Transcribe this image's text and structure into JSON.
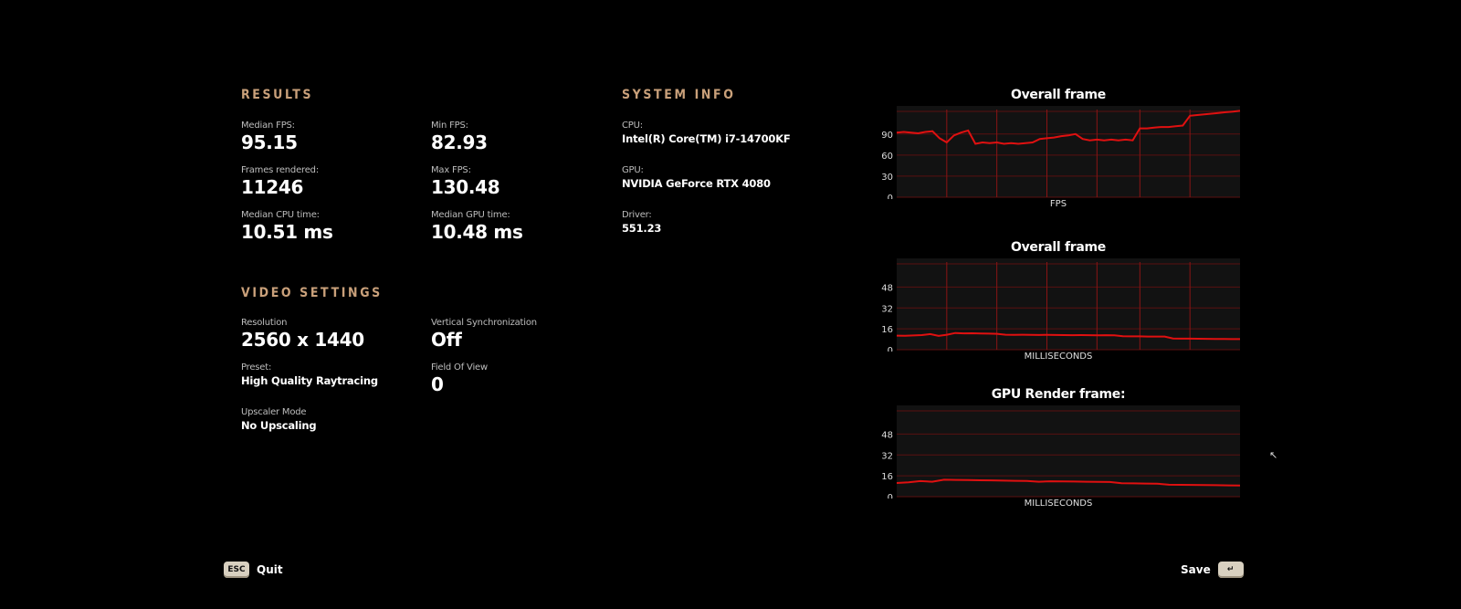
{
  "results": {
    "title": "RESULTS",
    "median_fps": {
      "label": "Median FPS:",
      "value": "95.15"
    },
    "min_fps": {
      "label": "Min FPS:",
      "value": "82.93"
    },
    "frames_rendered": {
      "label": "Frames rendered:",
      "value": "11246"
    },
    "max_fps": {
      "label": "Max FPS:",
      "value": "130.48"
    },
    "median_cpu": {
      "label": "Median CPU time:",
      "value": "10.51 ms"
    },
    "median_gpu": {
      "label": "Median GPU time:",
      "value": "10.48 ms"
    }
  },
  "video_settings": {
    "title": "VIDEO SETTINGS",
    "resolution": {
      "label": "Resolution",
      "value": "2560 x 1440"
    },
    "vsync": {
      "label": "Vertical Synchronization",
      "value": "Off"
    },
    "preset": {
      "label": "Preset:",
      "value": "High Quality Raytracing"
    },
    "fov": {
      "label": "Field Of View",
      "value": "0"
    },
    "upscaler": {
      "label": "Upscaler Mode",
      "value": "No Upscaling"
    }
  },
  "system_info": {
    "title": "SYSTEM INFO",
    "cpu": {
      "label": "CPU:",
      "value": "Intel(R) Core(TM) i7-14700KF"
    },
    "gpu": {
      "label": "GPU:",
      "value": "NVIDIA GeForce RTX 4080"
    },
    "driver": {
      "label": "Driver:",
      "value": "551.23"
    }
  },
  "footer": {
    "quit_key": "ESC",
    "quit_label": "Quit",
    "save_label": "Save",
    "save_key": "↵"
  },
  "colors": {
    "accent": "#c9a07a",
    "line": "#e01010",
    "grid": "#5a1010",
    "panel": "#121212"
  },
  "chart_data": [
    {
      "type": "line",
      "title": "Overall frame",
      "xlabel": "FPS",
      "yticks": [
        0,
        30,
        60,
        90
      ],
      "ylim": [
        0,
        130
      ],
      "series": [
        {
          "values": [
            92,
            93,
            92,
            91,
            93,
            94,
            84,
            78,
            88,
            92,
            95,
            76,
            78,
            77,
            78,
            76,
            77,
            76,
            77,
            78,
            83,
            84,
            85,
            87,
            88,
            90,
            83,
            81,
            82,
            81,
            82,
            81,
            82,
            81,
            98,
            98,
            99,
            100,
            100,
            101,
            102,
            116,
            117,
            118,
            119,
            120,
            121,
            122,
            123
          ]
        }
      ],
      "spikes": [
        7,
        14,
        21,
        28,
        34,
        41
      ]
    },
    {
      "type": "line",
      "title": "Overall frame",
      "xlabel": "MILLISECONDS",
      "yticks": [
        0,
        16,
        32,
        48
      ],
      "ylim": [
        0,
        70
      ],
      "series": [
        {
          "values": [
            10.8,
            10.7,
            10.9,
            11.2,
            12,
            10.6,
            11.5,
            12.8,
            12.5,
            12.6,
            12.4,
            12.3,
            12.2,
            11.5,
            11.4,
            11.5,
            11.4,
            11.3,
            11.4,
            11.3,
            11.2,
            11.1,
            11.2,
            11.1,
            11.0,
            11.1,
            11.0,
            10.3,
            10.2,
            10.2,
            10.1,
            10.1,
            10.1,
            8.6,
            8.5,
            8.5,
            8.4,
            8.3,
            8.2,
            8.2,
            8.1,
            8.1
          ]
        }
      ],
      "spikes": [
        7,
        14,
        21,
        28,
        34,
        41
      ]
    },
    {
      "type": "line",
      "title": "GPU Render frame:",
      "xlabel": "MILLISECONDS",
      "yticks": [
        0,
        16,
        32,
        48
      ],
      "ylim": [
        0,
        70
      ],
      "series": [
        {
          "values": [
            10.5,
            11,
            12,
            11.5,
            13,
            12.9,
            12.8,
            12.6,
            12.5,
            12.3,
            12.2,
            12.1,
            11.5,
            11.8,
            11.7,
            11.6,
            11.5,
            11.4,
            11.3,
            10.3,
            10.2,
            10.1,
            10.0,
            9.2,
            9.1,
            9.0,
            8.9,
            8.8,
            8.7,
            8.6
          ]
        }
      ],
      "spikes": []
    }
  ]
}
